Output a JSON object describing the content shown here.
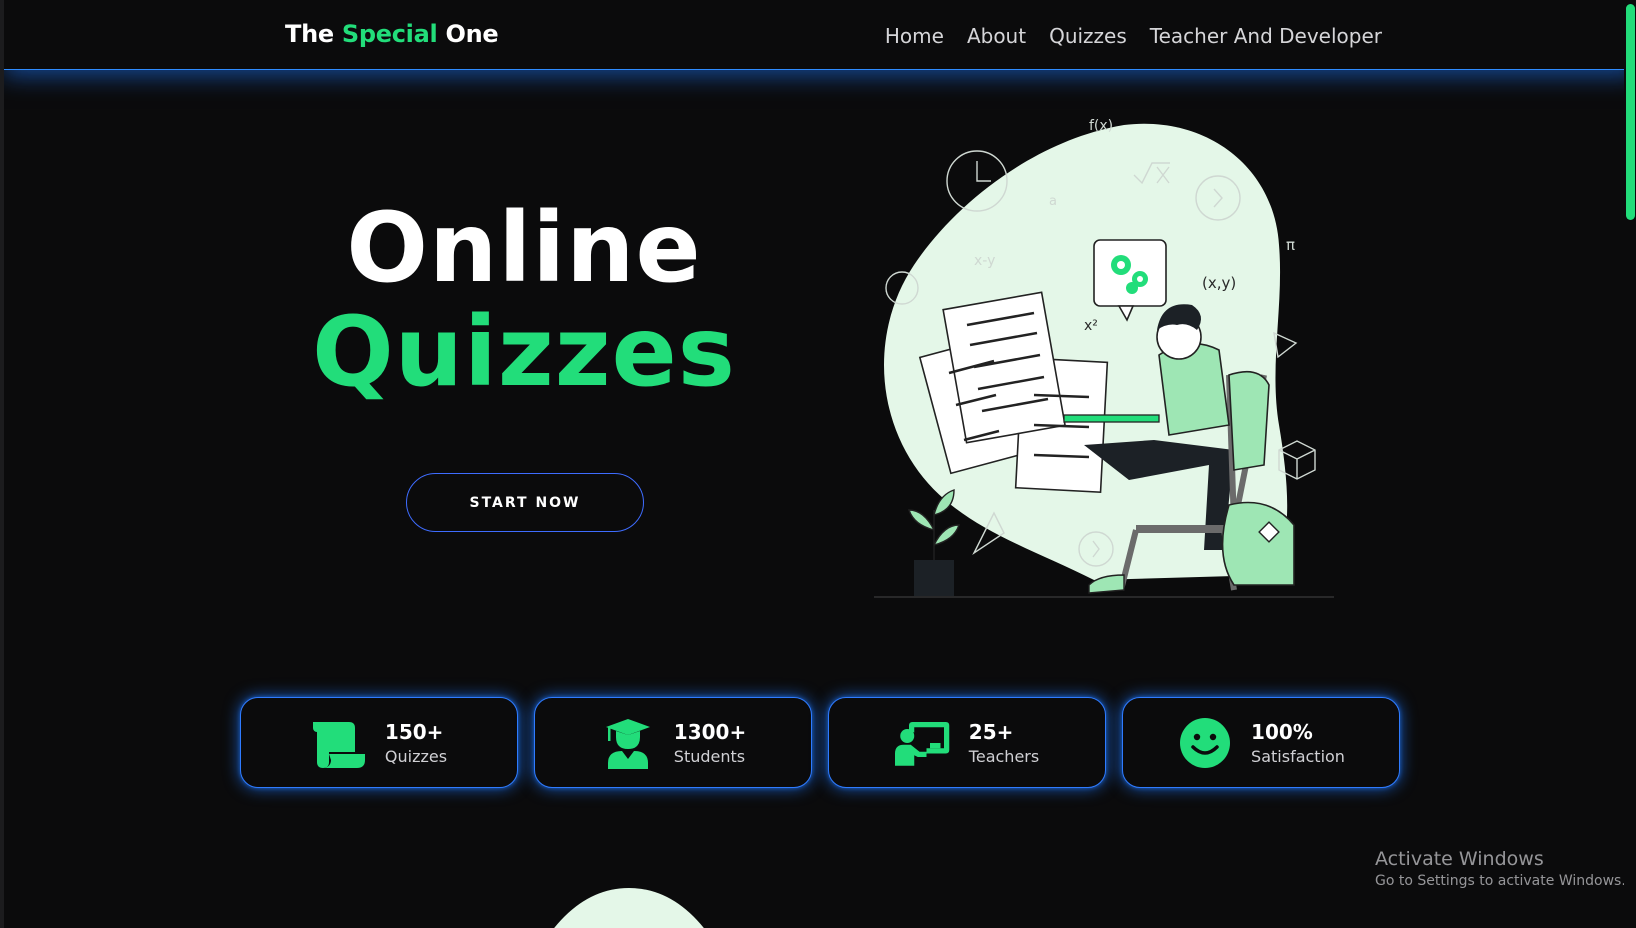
{
  "nav": {
    "logo": {
      "part1": "The",
      "part2": "Special",
      "part3": "One"
    },
    "links": [
      "Home",
      "About",
      "Quizzes",
      "Teacher And Developer"
    ]
  },
  "hero": {
    "title_line1": "Online",
    "title_line2": "Quizzes",
    "cta_label": "START NOW"
  },
  "stats": [
    {
      "icon": "scroll-icon",
      "value": "150+",
      "label": "Quizzes"
    },
    {
      "icon": "graduate-icon",
      "value": "1300+",
      "label": "Students"
    },
    {
      "icon": "teacher-board-icon",
      "value": "25+",
      "label": "Teachers"
    },
    {
      "icon": "smiley-icon",
      "value": "100%",
      "label": "Satisfaction"
    }
  ],
  "watermark": {
    "title": "Activate Windows",
    "subtitle": "Go to Settings to activate Windows."
  },
  "colors": {
    "accent_green": "#22dd7a",
    "glow_blue": "#2f7bff",
    "background": "#0b0b0c",
    "blob_mint": "#e4f7e8"
  }
}
